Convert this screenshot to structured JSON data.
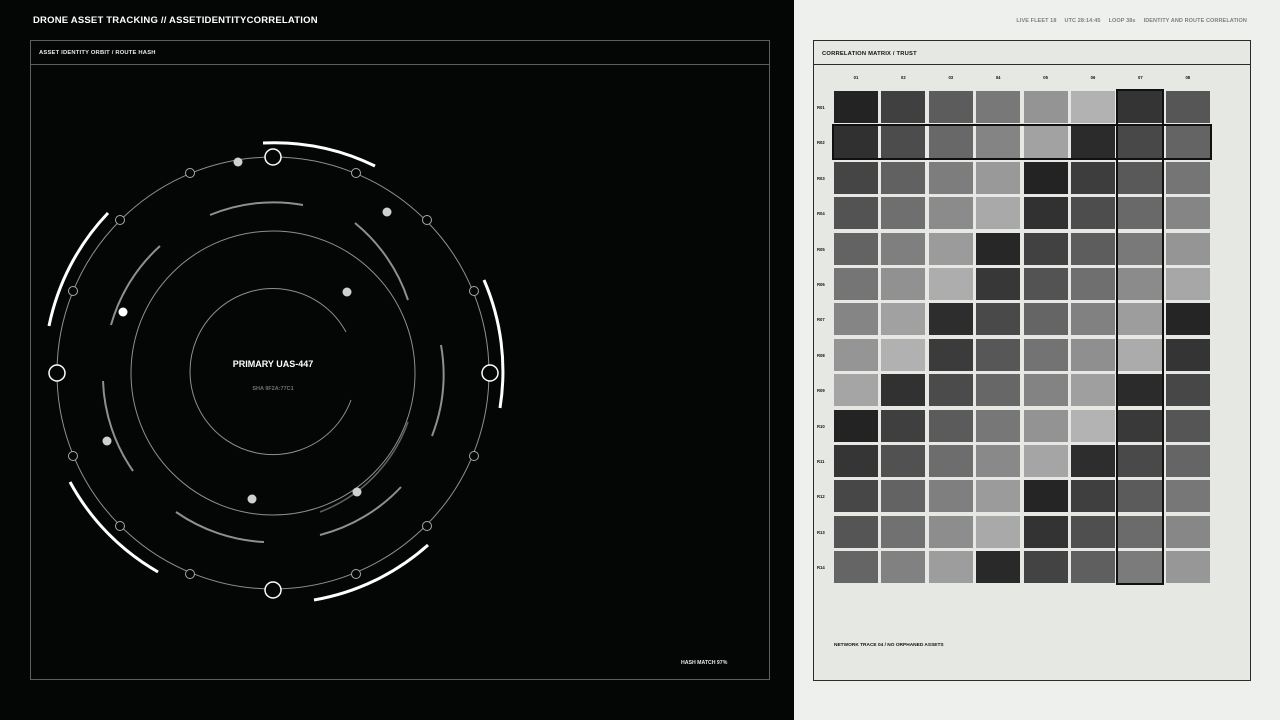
{
  "header": {
    "title": "DRONE ASSET TRACKING // ASSETIDENTITYCORRELATION",
    "status": [
      "LIVE FLEET 18",
      "UTC 28:14:45",
      "LOOP 38s",
      "IDENTITY AND ROUTE CORRELATION"
    ]
  },
  "left_panel": {
    "title": "ASSET IDENTITY ORBIT / ROUTE HASH",
    "center_label": "PRIMARY UAS-447",
    "center_sub": "SHA 9F2A:77C1",
    "footer": "HASH MATCH 97%"
  },
  "right_panel": {
    "title": "CORRELATION MATRIX / TRUST",
    "footer": "NETWORK TRACE 04 / NO ORPHANED ASSETS",
    "columns": [
      "01",
      "02",
      "03",
      "04",
      "05",
      "06",
      "07",
      "08"
    ],
    "rows": [
      "R01",
      "R02",
      "R03",
      "R04",
      "R05",
      "R06",
      "R07",
      "R08",
      "R09",
      "R10",
      "R11",
      "R12",
      "R13",
      "R14"
    ],
    "highlight_column": "07",
    "highlight_row": "R02",
    "cells": [
      [
        "#222322",
        "#3f403f",
        "#5b5c5b",
        "#777877",
        "#939493",
        "#b1b2b1",
        "#333433",
        "#555655"
      ],
      [
        "#2f302f",
        "#4b4c4b",
        "#676867",
        "#838483",
        "#a1a2a1",
        "#2a2b2a",
        "#474847",
        "#636463"
      ],
      [
        "#444544",
        "#606160",
        "#7c7d7c",
        "#989998",
        "#222322",
        "#3c3d3c",
        "#585958",
        "#747574"
      ],
      [
        "#525352",
        "#6e6f6e",
        "#8a8b8a",
        "#a8a9a8",
        "#303130",
        "#4c4d4c",
        "#686968",
        "#848584"
      ],
      [
        "#626362",
        "#7e7f7e",
        "#9a9b9a",
        "#262726",
        "#404140",
        "#5c5d5c",
        "#787978",
        "#949594"
      ],
      [
        "#747574",
        "#909190",
        "#acadac",
        "#363736",
        "#525352",
        "#6e6f6e",
        "#8a8b8a",
        "#a6a7a6"
      ],
      [
        "#848584",
        "#a0a1a0",
        "#2c2d2c",
        "#484948",
        "#646564",
        "#808180",
        "#9c9d9c",
        "#242524"
      ],
      [
        "#949594",
        "#b0b1b0",
        "#3a3b3a",
        "#565756",
        "#727372",
        "#8e8f8e",
        "#aaabaa",
        "#333433"
      ],
      [
        "#a4a5a4",
        "#303130",
        "#4a4b4a",
        "#666766",
        "#828382",
        "#9e9f9e",
        "#2a2b2a",
        "#464746"
      ],
      [
        "#222322",
        "#3e3f3e",
        "#5a5b5a",
        "#767776",
        "#929392",
        "#b2b3b2",
        "#383938",
        "#545554"
      ],
      [
        "#343534",
        "#505150",
        "#6c6d6c",
        "#888988",
        "#a4a5a4",
        "#2c2d2c",
        "#484948",
        "#646564"
      ],
      [
        "#464746",
        "#626362",
        "#7e7f7e",
        "#9a9b9a",
        "#242524",
        "#3e3f3e",
        "#5a5b5a",
        "#767776"
      ],
      [
        "#545554",
        "#707170",
        "#8c8d8c",
        "#a8a9a8",
        "#323332",
        "#4e4f4e",
        "#6a6b6a",
        "#868786"
      ],
      [
        "#646564",
        "#808180",
        "#9c9d9c",
        "#282928",
        "#424342",
        "#5e5f5e",
        "#7a7b7a",
        "#969796"
      ]
    ]
  }
}
